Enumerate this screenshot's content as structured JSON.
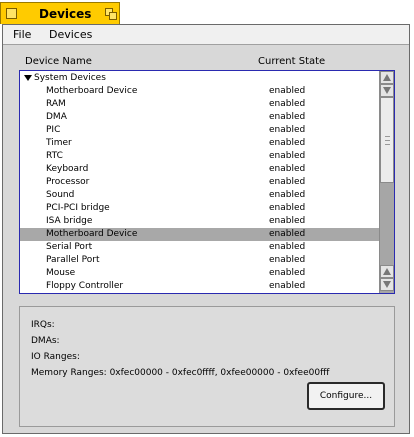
{
  "window": {
    "title": "Devices"
  },
  "menu": {
    "file": "File",
    "devices": "Devices"
  },
  "columns": {
    "name": "Device Name",
    "state": "Current State"
  },
  "tree": {
    "group_label": "System Devices",
    "rows": [
      {
        "name": "Motherboard Device",
        "state": "enabled",
        "selected": false
      },
      {
        "name": "RAM",
        "state": "enabled",
        "selected": false
      },
      {
        "name": "DMA",
        "state": "enabled",
        "selected": false
      },
      {
        "name": "PIC",
        "state": "enabled",
        "selected": false
      },
      {
        "name": "Timer",
        "state": "enabled",
        "selected": false
      },
      {
        "name": "RTC",
        "state": "enabled",
        "selected": false
      },
      {
        "name": "Keyboard",
        "state": "enabled",
        "selected": false
      },
      {
        "name": "Processor",
        "state": "enabled",
        "selected": false
      },
      {
        "name": "Sound",
        "state": "enabled",
        "selected": false
      },
      {
        "name": "PCI-PCI bridge",
        "state": "enabled",
        "selected": false
      },
      {
        "name": "ISA bridge",
        "state": "enabled",
        "selected": false
      },
      {
        "name": "Motherboard Device",
        "state": "enabled",
        "selected": true
      },
      {
        "name": "Serial Port",
        "state": "enabled",
        "selected": false
      },
      {
        "name": "Parallel Port",
        "state": "enabled",
        "selected": false
      },
      {
        "name": "Mouse",
        "state": "enabled",
        "selected": false
      },
      {
        "name": "Floppy Controller",
        "state": "enabled",
        "selected": false
      }
    ]
  },
  "details": {
    "irqs": "IRQs:",
    "dmas": "DMAs:",
    "io_ranges": "IO Ranges:",
    "memory_ranges": "Memory Ranges: 0xfec00000 - 0xfec0ffff, 0xfee00000 - 0xfee00fff"
  },
  "buttons": {
    "configure": "Configure..."
  },
  "colors": {
    "tab": "#ffcb00",
    "selection": "#a8a8a8",
    "list_border": "#2a2ab0"
  }
}
